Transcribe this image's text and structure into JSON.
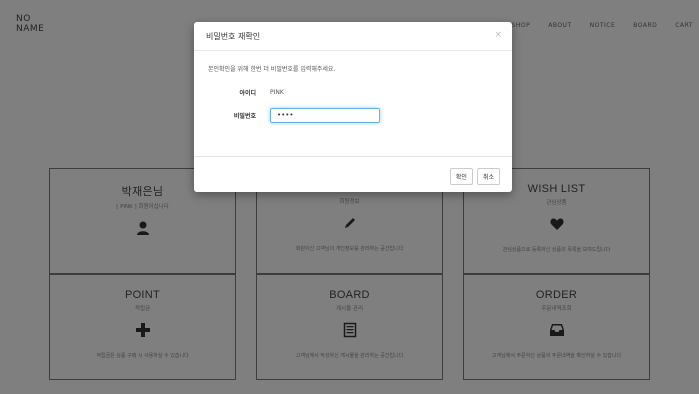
{
  "header": {
    "logo_line1": "NO",
    "logo_line2": "NAME",
    "nav": [
      "SHOP",
      "ABOUT",
      "NOTICE",
      "BOARD",
      "CART"
    ]
  },
  "cards": [
    {
      "title": "박재은님",
      "subtitle": "[ PINK ] 회원이십니다",
      "description": "",
      "icon": "user-icon"
    },
    {
      "title": "",
      "subtitle": "회원정보",
      "description": "회원이신 고객님의 개인정보를 관리하는 공간입니다",
      "icon": "pencil-icon"
    },
    {
      "title": "WISH LIST",
      "subtitle": "관심상품",
      "description": "관심상품으로 등록하신 상품의 목록을 보여드립니다",
      "icon": "heart-icon"
    },
    {
      "title": "POINT",
      "subtitle": "적립금",
      "description": "적립금은 상품 구매 시 사용하실 수 있습니다",
      "icon": "plus-icon"
    },
    {
      "title": "BOARD",
      "subtitle": "게시물 관리",
      "description": "고객님께서 작성하신 게시물을 관리하는 공간입니다",
      "icon": "document-icon"
    },
    {
      "title": "ORDER",
      "subtitle": "주문내역조회",
      "description": "고객님께서 주문하신 상품의 주문내역을 확인하실 수 있습니다",
      "icon": "inbox-icon"
    }
  ],
  "modal": {
    "title": "비밀번호 재확인",
    "close": "×",
    "notice": "본인확인을 위해 한번 더 비밀번호를 입력해주세요.",
    "id_label": "아이디",
    "id_value": "PINK",
    "pw_label": "비밀번호",
    "pw_value": "••••",
    "confirm_label": "확인",
    "cancel_label": "취소"
  }
}
